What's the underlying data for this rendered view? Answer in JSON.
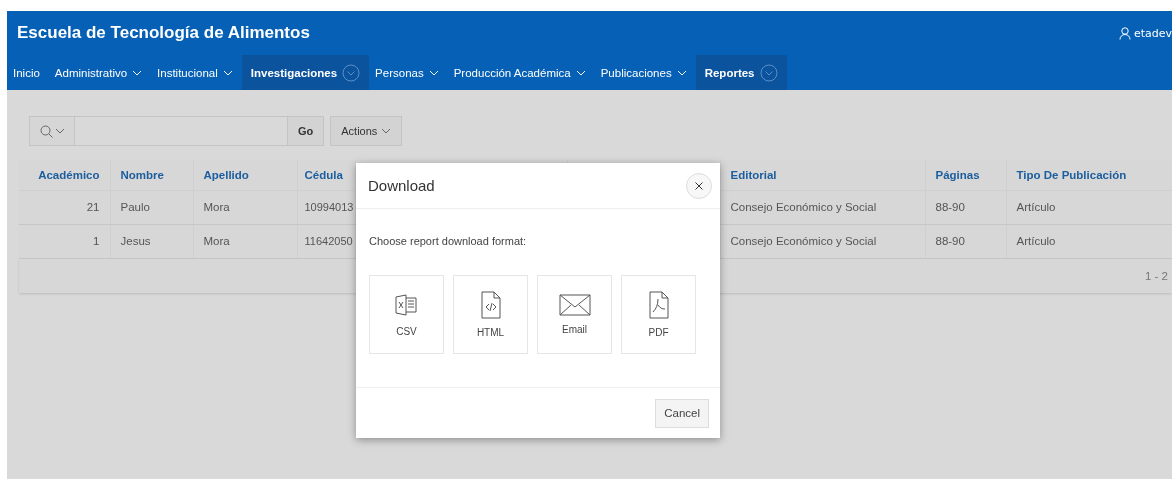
{
  "header": {
    "title": "Escuela de Tecnología de Alimentos",
    "user": "etadev"
  },
  "nav": [
    {
      "label": "Inicio",
      "selected": false,
      "kind": "plain"
    },
    {
      "label": "Administrativo",
      "selected": false,
      "kind": "menu"
    },
    {
      "label": "Institucional",
      "selected": false,
      "kind": "menu"
    },
    {
      "label": "Investigaciones",
      "selected": true,
      "kind": "menu"
    },
    {
      "label": "Personas",
      "selected": false,
      "kind": "menu"
    },
    {
      "label": "Producción Académica",
      "selected": false,
      "kind": "menu"
    },
    {
      "label": "Publicaciones",
      "selected": false,
      "kind": "menu"
    },
    {
      "label": "Reportes",
      "selected": true,
      "kind": "menu"
    }
  ],
  "toolbar": {
    "go": "Go",
    "actions": "Actions"
  },
  "table": {
    "columns": [
      "Académico",
      "Nombre",
      "Apellido",
      "Cédula",
      "",
      "",
      "Editorial",
      "Páginas",
      "Tipo De Publicación"
    ],
    "rows": [
      [
        "21",
        "Paulo",
        "Mora",
        "10994013",
        "",
        "",
        "Consejo Económico y Social",
        "88-90",
        "Artículo"
      ],
      [
        "1",
        "Jesus",
        "Mora",
        "11642050",
        "",
        "",
        "Consejo Económico y Social",
        "88-90",
        "Artículo"
      ]
    ],
    "pagination": "1 - 2"
  },
  "dialog": {
    "title": "Download",
    "prompt": "Choose report download format:",
    "formats": [
      {
        "label": "CSV",
        "kind": "csv"
      },
      {
        "label": "HTML",
        "kind": "html"
      },
      {
        "label": "Email",
        "kind": "email"
      },
      {
        "label": "PDF",
        "kind": "pdf"
      }
    ],
    "cancel": "Cancel"
  }
}
